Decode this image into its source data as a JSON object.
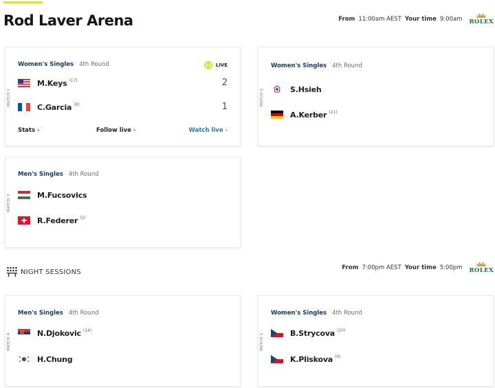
{
  "header": {
    "title": "Rod Laver Arena"
  },
  "day_schedule": {
    "from_label": "From",
    "from_time": "11:00am AEST",
    "your_label": "Your time",
    "your_time": "9:00am"
  },
  "night": {
    "title": "NIGHT SESSIONS",
    "schedule": {
      "from_label": "From",
      "from_time": "7:00pm AEST",
      "your_label": "Your time",
      "your_time": "5:00pm"
    }
  },
  "sponsor": "ROLEX",
  "colors": {
    "accent": "#d7e33c",
    "event_name": "#153a6b",
    "link_blue": "#1f7cc5",
    "rolex_green": "#1e6b3d"
  },
  "matches": [
    {
      "label": "MATCH 1",
      "event": "Women's Singles",
      "round": "4th Round",
      "live": "LIVE",
      "players": [
        {
          "name": "M.Keys",
          "seed": "(17)",
          "flag": "usa-flag",
          "score": "2"
        },
        {
          "name": "C.Garcia",
          "seed": "(8)",
          "flag": "france-flag",
          "score": "1"
        }
      ],
      "links": {
        "stats": "Stats",
        "follow": "Follow live",
        "watch": "Watch live"
      }
    },
    {
      "label": "MATCH 2",
      "event": "Women's Singles",
      "round": "4th Round",
      "players": [
        {
          "name": "S.Hsieh",
          "seed": "",
          "flag": "chinese-taipei-flag"
        },
        {
          "name": "A.Kerber",
          "seed": "(21)",
          "flag": "germany-flag"
        }
      ]
    },
    {
      "label": "MATCH 3",
      "event": "Men's Singles",
      "round": "4th Round",
      "players": [
        {
          "name": "M.Fucsovics",
          "seed": "",
          "flag": "hungary-flag"
        },
        {
          "name": "R.Federer",
          "seed": "(2)",
          "flag": "switzerland-flag"
        }
      ]
    },
    {
      "label": "MATCH 4",
      "event": "Men's Singles",
      "round": "4th Round",
      "players": [
        {
          "name": "N.Djokovic",
          "seed": "(14)",
          "flag": "serbia-flag"
        },
        {
          "name": "H.Chung",
          "seed": "",
          "flag": "korea-flag"
        }
      ]
    },
    {
      "label": "MATCH 5",
      "event": "Women's Singles",
      "round": "4th Round",
      "players": [
        {
          "name": "B.Strycova",
          "seed": "(20)",
          "flag": "czech-flag"
        },
        {
          "name": "K.Pliskova",
          "seed": "(6)",
          "flag": "czech-flag"
        }
      ]
    }
  ]
}
